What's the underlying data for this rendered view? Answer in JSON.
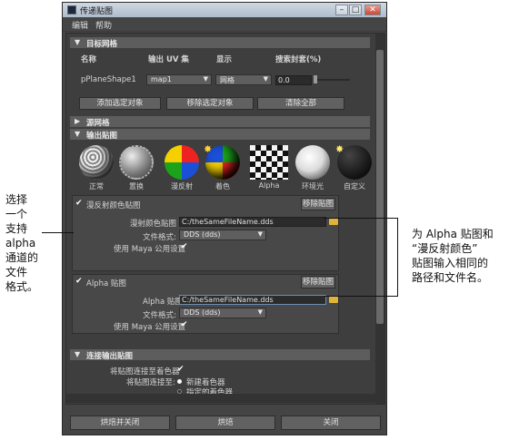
{
  "window": {
    "title": "传递贴图",
    "menu": [
      "编辑",
      "帮助"
    ],
    "controls": {
      "minimize": "–",
      "maximize": "□",
      "close": "✕"
    }
  },
  "target_mesh": {
    "section_label": "目标网格",
    "headers": {
      "name": "名称",
      "uv_set": "输出 UV 集",
      "display": "显示",
      "envelope": "搜索封套(%)"
    },
    "row": {
      "name": "pPlaneShape1",
      "uv_set": "map1",
      "display": "网格",
      "envelope": "0.0"
    },
    "buttons": {
      "add": "添加选定对象",
      "remove": "移除选定对象",
      "clear": "清除全部"
    }
  },
  "source_mesh": {
    "section_label": "源网格"
  },
  "output_maps": {
    "section_label": "输出贴图",
    "map_types": [
      "正常",
      "置换",
      "漫反射",
      "着色",
      "Alpha",
      "环境光",
      "自定义"
    ],
    "diffuse": {
      "checkbox_label": "漫反射颜色贴图",
      "remove_button": "移除贴图",
      "map_label": "漫射颜色贴图",
      "map_value": "C:/theSameFileName.dds",
      "format_label": "文件格式:",
      "format_value": "DDS (dds)",
      "maya_label": "使用 Maya 公用设置"
    },
    "alpha": {
      "checkbox_label": "Alpha 贴图",
      "remove_button": "移除贴图",
      "map_label": "Alpha 贴图",
      "map_value": "C:/theSameFileName.dds",
      "format_label": "文件格式:",
      "format_value": "DDS (dds)",
      "maya_label": "使用 Maya 公用设置"
    }
  },
  "connect_maps": {
    "section_label": "连接输出贴图",
    "connect_label": "将贴图连接至着色器",
    "connect_to_label": "将贴图连接至:",
    "option_new": "新建着色器",
    "option_assigned": "指定的着色器"
  },
  "footer": {
    "bake_close": "烘焙并关闭",
    "bake": "烘焙",
    "close": "关闭"
  },
  "annotations": {
    "left": [
      "选择",
      "一个",
      "支持",
      "alpha",
      "通道的",
      "文件",
      "格式。"
    ],
    "right": [
      "为 Alpha 贴图和",
      "“漫反射颜色”",
      "贴图输入相同的",
      "路径和文件名。"
    ]
  }
}
